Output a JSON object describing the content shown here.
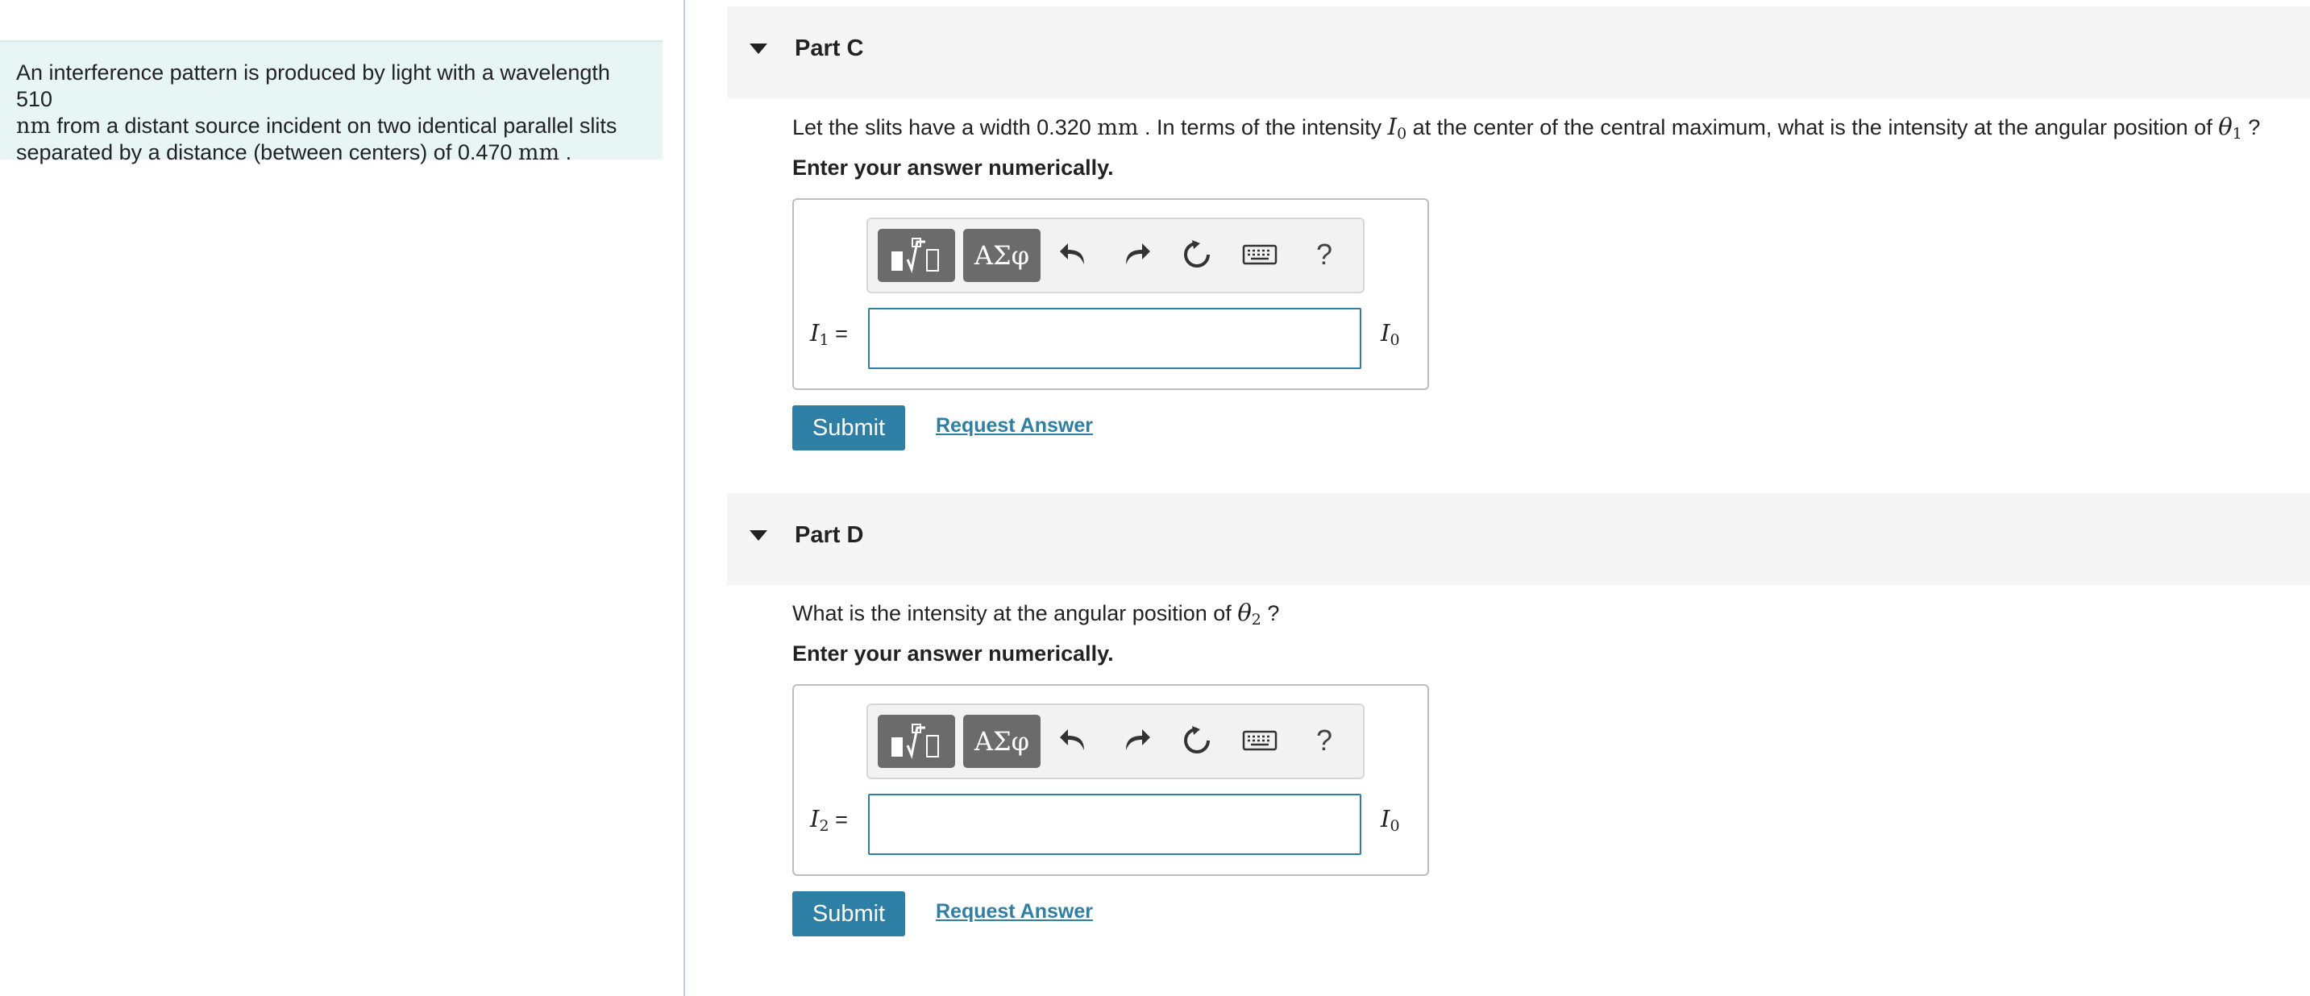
{
  "intro": {
    "part1": "An interference pattern is produced by light with a wavelength 510",
    "unit_nm": "nm",
    "part2": " from a distant source incident on two identical parallel slits",
    "part3": "separated by a distance (between centers) of 0.470 ",
    "unit_mm": "mm",
    "part4": " ."
  },
  "toolbar": {
    "templates_icon": "templates-icon",
    "greek_label": "ΑΣφ",
    "undo_icon": "undo-icon",
    "redo_icon": "redo-icon",
    "reset_icon": "reset-icon",
    "keyboard_icon": "keyboard-icon",
    "help_label": "?"
  },
  "parts": [
    {
      "title": "Part C",
      "question": {
        "t1": "Let the slits have a width 0.320 ",
        "unit": "mm",
        "t2": " . In terms of the intensity ",
        "var_i": "I",
        "var_i_sub": "0",
        "t3": " at the center of the central maximum, what is the intensity at the angular position of ",
        "var_theta": "θ",
        "var_theta_sub": "1",
        "t4": " ?"
      },
      "instruction": "Enter your answer numerically.",
      "answer": {
        "var": "I",
        "var_sub": "1",
        "equals": "=",
        "value": "",
        "units_var": "I",
        "units_sub": "0"
      },
      "submit_label": "Submit",
      "request_label": "Request Answer"
    },
    {
      "title": "Part D",
      "question": {
        "t1": "What is the intensity at the angular position of ",
        "var_theta": "θ",
        "var_theta_sub": "2",
        "t2": " ?"
      },
      "instruction": "Enter your answer numerically.",
      "answer": {
        "var": "I",
        "var_sub": "2",
        "equals": "=",
        "value": "",
        "units_var": "I",
        "units_sub": "0"
      },
      "submit_label": "Submit",
      "request_label": "Request Answer"
    }
  ],
  "colors": {
    "accent": "#2e7fa6",
    "intro_bg": "#e7f5f5",
    "header_bg": "#f5f5f5",
    "toolbar_button": "#6b6b6b"
  }
}
